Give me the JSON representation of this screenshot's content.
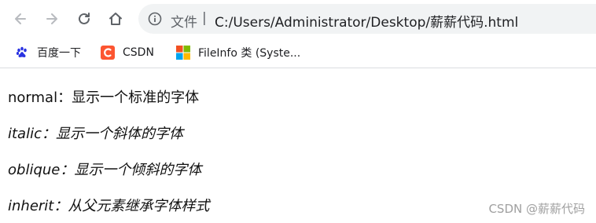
{
  "browser": {
    "scheme_label": "文件",
    "separator": "|",
    "url": "C:/Users/Administrator/Desktop/薪薪代码.html",
    "nav_icons": [
      "back-arrow-icon",
      "forward-arrow-icon",
      "reload-icon",
      "home-icon",
      "info-icon"
    ]
  },
  "bookmarks": [
    {
      "label": "百度一下",
      "icon": "baidu-paw-icon"
    },
    {
      "label": "CSDN",
      "icon": "csdn-logo-icon",
      "color": "#fc5531"
    },
    {
      "label": "FileInfo 类 (Syste...",
      "icon": "windows-logo-icon"
    }
  ],
  "content": {
    "lines": [
      {
        "text": "normal：显示一个标准的字体",
        "style": "normal"
      },
      {
        "text": "italic：显示一个斜体的字体",
        "style": "italic"
      },
      {
        "text": "oblique：显示一个倾斜的字体",
        "style": "oblique"
      },
      {
        "text": "inherit：从父元素继承字体样式",
        "style": "inherit"
      }
    ]
  },
  "watermark": "CSDN @薪薪代码"
}
